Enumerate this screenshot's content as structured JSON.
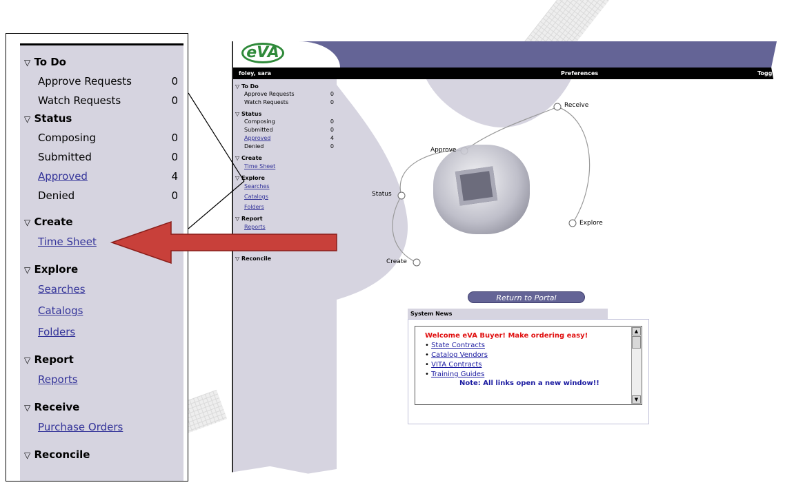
{
  "app": {
    "logo_text": "eVA",
    "user_name": "foley, sara",
    "preferences_label": "Preferences",
    "toggle_label": "Toggle",
    "header_color": "#646496"
  },
  "sidebar": {
    "todo": {
      "title": "To Do",
      "items": [
        {
          "label": "Approve Requests",
          "count": "0"
        },
        {
          "label": "Watch Requests",
          "count": "0"
        }
      ]
    },
    "status": {
      "title": "Status",
      "items": [
        {
          "label": "Composing",
          "count": "0"
        },
        {
          "label": "Submitted",
          "count": "0"
        },
        {
          "label": "Approved",
          "count": "4"
        },
        {
          "label": "Denied",
          "count": "0"
        }
      ]
    },
    "create": {
      "title": "Create",
      "links": [
        "Time Sheet"
      ]
    },
    "explore": {
      "title": "Explore",
      "links": [
        "Searches",
        "Catalogs",
        "Folders"
      ]
    },
    "report": {
      "title": "Report",
      "links": [
        "Reports"
      ]
    },
    "receive": {
      "title": "Receive",
      "links": [
        "Purchase Orders"
      ]
    },
    "reconcile": {
      "title": "Reconcile"
    }
  },
  "diagram": {
    "nodes": {
      "approve": "Approve",
      "receive": "Receive",
      "status": "Status",
      "explore": "Explore",
      "create": "Create"
    }
  },
  "portal_button": "Return to Portal",
  "news": {
    "tab_title": "System News",
    "headline": "Welcome eVA Buyer!  Make ordering easy!",
    "links": [
      "State Contracts",
      "Catalog Vendors",
      "VITA Contracts",
      "Training Guides"
    ],
    "note": "Note: All links open a new window!!"
  },
  "arrow_color": "#c8403a"
}
